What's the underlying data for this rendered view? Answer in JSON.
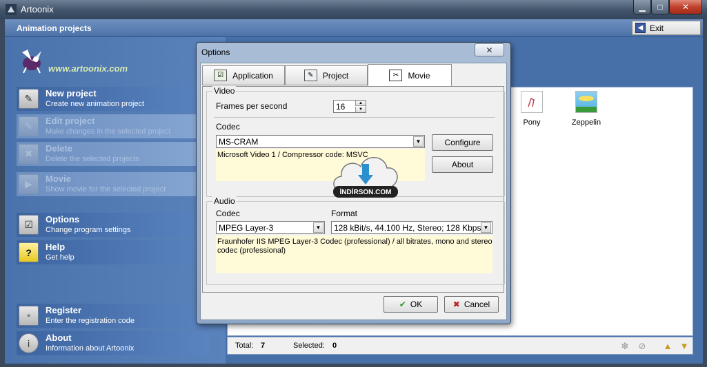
{
  "window": {
    "title": "Artoonix"
  },
  "app_header": {
    "title": "Animation projects",
    "exit_label": "Exit"
  },
  "logo": {
    "url": "www.artoonix.com"
  },
  "sidebar": {
    "items": [
      {
        "title": "New project",
        "subtitle": "Create new animation project",
        "enabled": true,
        "icon": "new-project-icon"
      },
      {
        "title": "Edit project",
        "subtitle": "Make changes in the selected project",
        "enabled": false,
        "icon": "edit-project-icon"
      },
      {
        "title": "Delete",
        "subtitle": "Delete the selected projects",
        "enabled": false,
        "icon": "delete-icon"
      },
      {
        "title": "Movie",
        "subtitle": "Show movie for the selected project",
        "enabled": false,
        "icon": "movie-icon"
      },
      {
        "title": "Options",
        "subtitle": "Change program settings",
        "enabled": true,
        "icon": "options-icon"
      },
      {
        "title": "Help",
        "subtitle": "Get help",
        "enabled": true,
        "icon": "help-icon"
      },
      {
        "title": "Register",
        "subtitle": "Enter the registration code",
        "enabled": true,
        "icon": "register-icon"
      },
      {
        "title": "About",
        "subtitle": "Information about Artoonix",
        "enabled": true,
        "icon": "about-icon"
      }
    ]
  },
  "projects": [
    {
      "name": "Pony"
    },
    {
      "name": "Zeppelin"
    }
  ],
  "status": {
    "total_label": "Total:",
    "total_value": "7",
    "selected_label": "Selected:",
    "selected_value": "0"
  },
  "dialog": {
    "title": "Options",
    "close_glyph": "✕",
    "tabs": [
      {
        "label": "Application",
        "active": false
      },
      {
        "label": "Project",
        "active": false
      },
      {
        "label": "Movie",
        "active": true
      }
    ],
    "video": {
      "legend": "Video",
      "fps_label": "Frames per second",
      "fps_value": "16",
      "codec_label": "Codec",
      "codec_value": "MS-CRAM",
      "codec_info": "Microsoft Video 1 / Compressor code: MSVC",
      "configure_label": "Configure",
      "about_label": "About"
    },
    "audio": {
      "legend": "Audio",
      "codec_label": "Codec",
      "codec_value": "MPEG Layer-3",
      "format_label": "Format",
      "format_value": "128 kBit/s, 44.100 Hz, Stereo; 128 Kbps",
      "codec_info": "Fraunhofer IIS MPEG Layer-3 Codec (professional) / all bitrates, mono and stereo codec (professional)"
    },
    "ok_label": "OK",
    "cancel_label": "Cancel"
  },
  "watermark": {
    "text": "İNDİRSON.COM"
  },
  "colors": {
    "sidebar_bg": "#4a72ab",
    "dialog_info_bg": "#fffbd9",
    "close_red": "#c0412d"
  }
}
